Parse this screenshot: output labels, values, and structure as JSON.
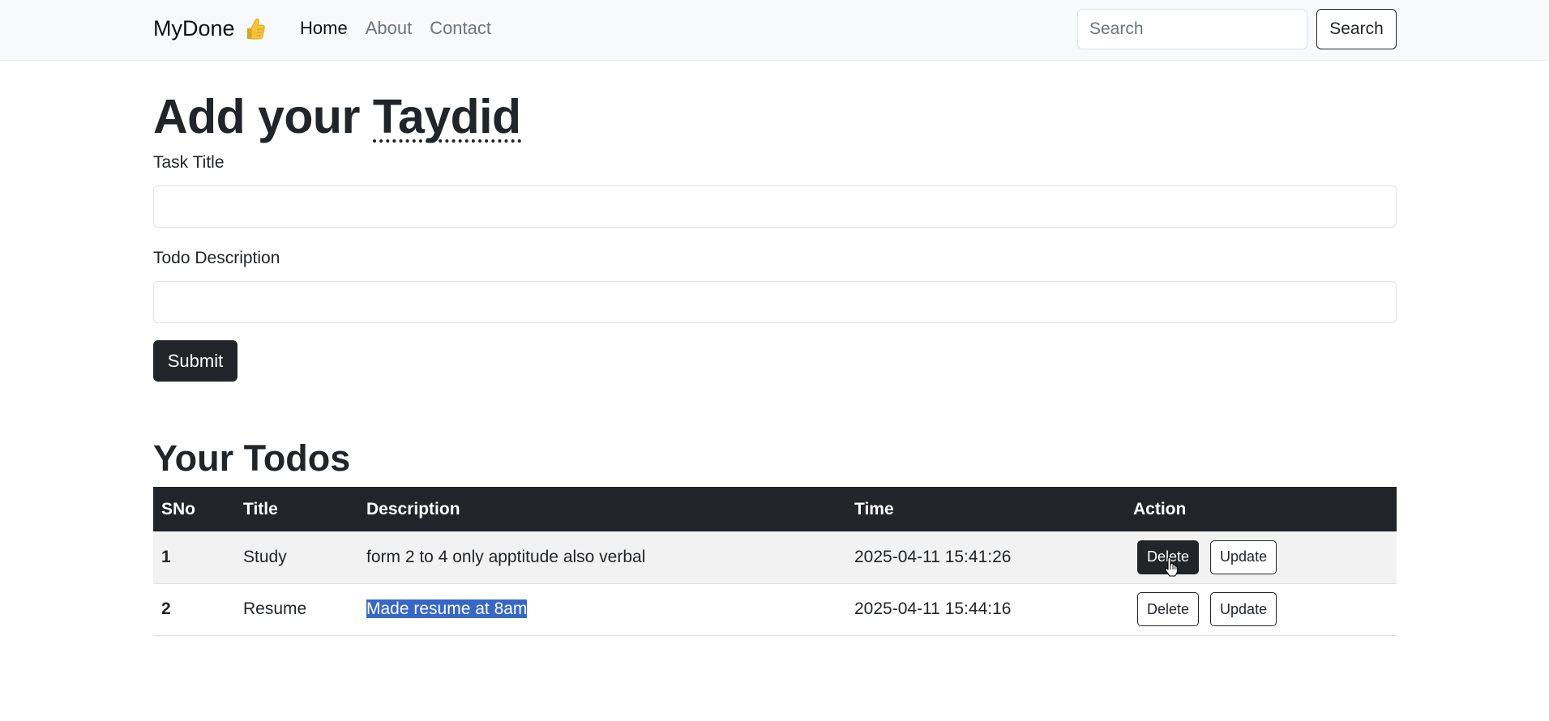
{
  "navbar": {
    "brand": "MyDone",
    "brand_icon": "thumbs-up-icon",
    "links": [
      {
        "label": "Home",
        "active": true
      },
      {
        "label": "About",
        "active": false
      },
      {
        "label": "Contact",
        "active": false
      }
    ],
    "search": {
      "placeholder": "Search",
      "value": "",
      "button_label": "Search"
    }
  },
  "form": {
    "heading_prefix": "Add your ",
    "heading_word": "Taydid",
    "title_label": "Task Title",
    "title_value": "",
    "description_label": "Todo Description",
    "description_value": "",
    "submit_label": "Submit"
  },
  "todos": {
    "heading": "Your Todos",
    "columns": [
      "SNo",
      "Title",
      "Description",
      "Time",
      "Action"
    ],
    "rows": [
      {
        "sno": "1",
        "title": "Study",
        "description": "form 2 to 4 only apptitude also verbal",
        "time": "2025-04-11 15:41:26",
        "delete_label": "Delete",
        "update_label": "Update"
      },
      {
        "sno": "2",
        "title": "Resume",
        "description": "Made resume at 8am",
        "time": "2025-04-11 15:44:16",
        "delete_label": "Delete",
        "update_label": "Update"
      }
    ]
  },
  "colors": {
    "navbar_bg": "#f8f9fa",
    "dark": "#212529",
    "selection": "#3767c9",
    "stripe": "#f2f2f2"
  }
}
